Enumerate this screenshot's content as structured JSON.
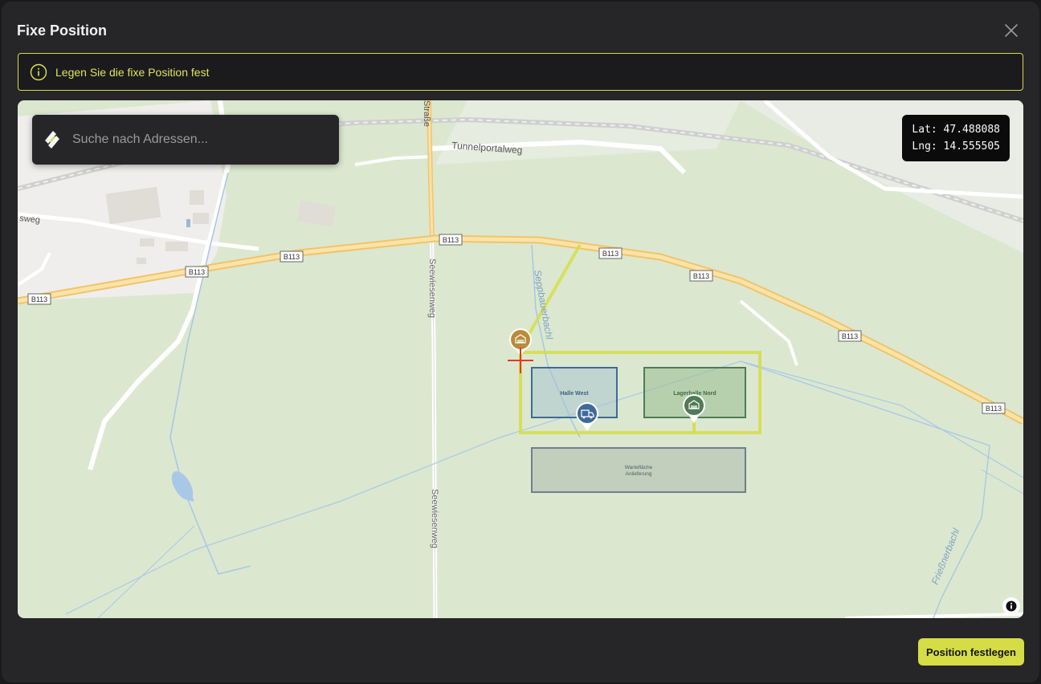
{
  "dialog": {
    "title": "Fixe Position",
    "notice": "Legen Sie die fixe Position fest",
    "primary_button": "Position festlegen"
  },
  "map": {
    "search_placeholder": "Suche nach Adressen...",
    "lat_text": "Lat: 47.488088",
    "lng_text": "Lng: 14.555505",
    "road_shields": [
      "B113",
      "B113",
      "B113",
      "B113",
      "B113",
      "B113",
      "B113",
      "B113"
    ],
    "street_labels": [
      "Tunnelportalweg",
      "Straße",
      "Seewiesenweg",
      "Seewiesenweg",
      "Seppbauerbachl",
      "Frießnerbachl",
      "sweg"
    ],
    "zones": [
      {
        "name": "Halle West"
      },
      {
        "name": "Lagerhalle Nord"
      },
      {
        "line1": "Wartefläche",
        "line2": "Anlieferung"
      }
    ],
    "markers": [
      {
        "icon": "warehouse-icon",
        "color": "#b98c3a"
      },
      {
        "icon": "truck-icon",
        "color": "#3f6a98"
      },
      {
        "icon": "warehouse-icon",
        "color": "#4f7b55"
      }
    ]
  },
  "colors": {
    "accent": "#d6dc45",
    "modal_bg": "#262628",
    "map_bg": "#dbe8cf"
  }
}
